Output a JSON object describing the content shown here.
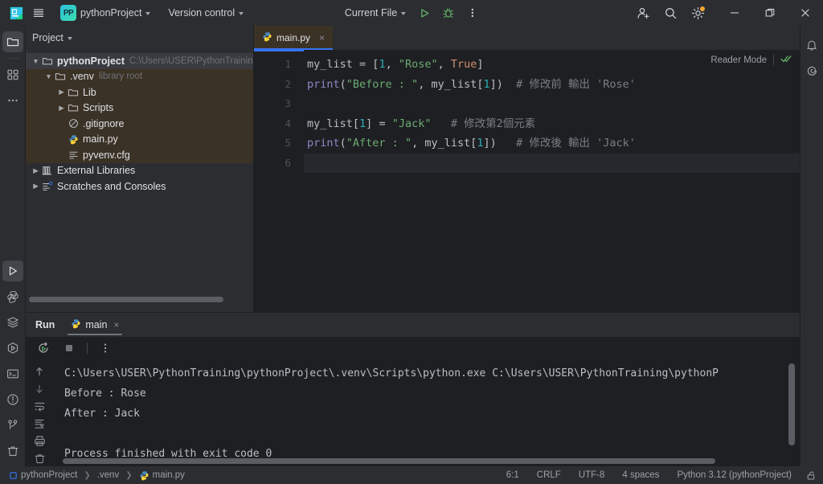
{
  "titlebar": {
    "app_icon": "pycharm-icon",
    "menu_icon": "hamburger-menu-icon",
    "project_badge": "PP",
    "project_name": "pythonProject",
    "version_control": "Version control",
    "run_config": "Current File",
    "run_icon": "run-icon",
    "debug_icon": "debug-icon",
    "more_icon": "more-vertical-icon",
    "account_icon": "add-account-icon",
    "search_icon": "search-icon",
    "settings_icon": "gear-icon",
    "minimize": "minimize-icon",
    "maximize": "maximize-icon",
    "close": "close-icon",
    "accent_blue": "#3574f0",
    "badge_orange": "#f0a732"
  },
  "left_rail": {
    "items": [
      {
        "name": "project-tool-window",
        "icon": "folder-icon",
        "active": true
      },
      {
        "name": "plugins-tool-window",
        "icon": "grid-icon",
        "active": false
      },
      {
        "name": "more-tool-windows",
        "icon": "ellipsis-icon",
        "active": false
      }
    ],
    "bottom_items": [
      {
        "name": "run-tool-window",
        "icon": "play-icon",
        "active": true
      },
      {
        "name": "python-console-tool-window",
        "icon": "python-icon",
        "active": false
      },
      {
        "name": "database-tool-window",
        "icon": "layers-icon",
        "active": false
      },
      {
        "name": "services-tool-window",
        "icon": "services-play-icon",
        "active": false
      },
      {
        "name": "terminal-tool-window",
        "icon": "terminal-icon",
        "active": false
      },
      {
        "name": "problems-tool-window",
        "icon": "warning-circle-icon",
        "active": false
      },
      {
        "name": "version-control-tool-window",
        "icon": "branch-icon",
        "active": false
      },
      {
        "name": "trash-tool-window",
        "icon": "trash-icon",
        "active": false
      }
    ]
  },
  "right_rail": {
    "items": [
      {
        "name": "notifications",
        "icon": "bell-icon"
      },
      {
        "name": "ai-assistant",
        "icon": "spiral-icon"
      }
    ]
  },
  "project_panel": {
    "header": "Project",
    "tree": [
      {
        "depth": 0,
        "arrow": "down",
        "icon": "folder-icon",
        "label": "pythonProject",
        "bold": true,
        "sub": "C:\\Users\\USER\\PythonTraining\\pythonP",
        "selected": true,
        "excluded": false
      },
      {
        "depth": 1,
        "arrow": "down",
        "icon": "folder-icon",
        "label": ".venv",
        "bold": false,
        "sub": "library root",
        "selected": false,
        "excluded": true
      },
      {
        "depth": 2,
        "arrow": "right",
        "icon": "folder-icon",
        "label": "Lib",
        "bold": false,
        "sub": "",
        "selected": false,
        "excluded": true
      },
      {
        "depth": 2,
        "arrow": "right",
        "icon": "folder-icon",
        "label": "Scripts",
        "bold": false,
        "sub": "",
        "selected": false,
        "excluded": true
      },
      {
        "depth": 2,
        "arrow": "none",
        "icon": "gitignore-icon",
        "label": ".gitignore",
        "bold": false,
        "sub": "",
        "selected": false,
        "excluded": true
      },
      {
        "depth": 2,
        "arrow": "none",
        "icon": "python-icon",
        "label": "main.py",
        "bold": false,
        "sub": "",
        "selected": false,
        "excluded": true
      },
      {
        "depth": 2,
        "arrow": "none",
        "icon": "config-icon",
        "label": "pyvenv.cfg",
        "bold": false,
        "sub": "",
        "selected": false,
        "excluded": true
      },
      {
        "depth": 0,
        "arrow": "right",
        "icon": "library-icon",
        "label": "External Libraries",
        "bold": false,
        "sub": "",
        "selected": false,
        "excluded": false
      },
      {
        "depth": 0,
        "arrow": "right",
        "icon": "scratches-icon",
        "label": "Scratches and Consoles",
        "bold": false,
        "sub": "",
        "selected": false,
        "excluded": false
      }
    ]
  },
  "editor": {
    "tab": {
      "label": "main.py",
      "icon": "python-icon",
      "close": "×"
    },
    "reader_mode": {
      "label": "Reader Mode",
      "check_icon": "double-check-icon",
      "check_color": "#5fad65"
    },
    "line_numbers": [
      "1",
      "2",
      "3",
      "4",
      "5",
      "6"
    ],
    "lines": [
      [
        {
          "t": "my_list ",
          "c": "tok-var"
        },
        {
          "t": "= ",
          "c": "tok-punct"
        },
        {
          "t": "[",
          "c": "tok-punct"
        },
        {
          "t": "1",
          "c": "tok-num"
        },
        {
          "t": ", ",
          "c": "tok-punct"
        },
        {
          "t": "\"Rose\"",
          "c": "tok-str"
        },
        {
          "t": ", ",
          "c": "tok-punct"
        },
        {
          "t": "True",
          "c": "tok-kw"
        },
        {
          "t": "]",
          "c": "tok-punct"
        }
      ],
      [
        {
          "t": "print",
          "c": "tok-fn"
        },
        {
          "t": "(",
          "c": "tok-punct"
        },
        {
          "t": "\"Before : \"",
          "c": "tok-str"
        },
        {
          "t": ", my_list[",
          "c": "tok-punct"
        },
        {
          "t": "1",
          "c": "tok-num"
        },
        {
          "t": "])",
          "c": "tok-punct"
        },
        {
          "t": "  # 修改前 輸出 'Rose'",
          "c": "tok-com"
        }
      ],
      [],
      [
        {
          "t": "my_list[",
          "c": "tok-var"
        },
        {
          "t": "1",
          "c": "tok-num"
        },
        {
          "t": "] ",
          "c": "tok-punct"
        },
        {
          "t": "= ",
          "c": "tok-punct"
        },
        {
          "t": "\"Jack\"",
          "c": "tok-str"
        },
        {
          "t": "   # 修改第2個元素",
          "c": "tok-com"
        }
      ],
      [
        {
          "t": "print",
          "c": "tok-fn"
        },
        {
          "t": "(",
          "c": "tok-punct"
        },
        {
          "t": "\"After : \"",
          "c": "tok-str"
        },
        {
          "t": ", my_list[",
          "c": "tok-punct"
        },
        {
          "t": "1",
          "c": "tok-num"
        },
        {
          "t": "])",
          "c": "tok-punct"
        },
        {
          "t": "   # 修改後 輸出 'Jack'",
          "c": "tok-com"
        }
      ],
      []
    ]
  },
  "run_panel": {
    "title": "Run",
    "tab": {
      "label": "main",
      "icon": "python-icon",
      "close": "×"
    },
    "toolbar": [
      {
        "name": "rerun-button",
        "icon": "rerun-icon"
      },
      {
        "name": "stop-button",
        "icon": "stop-icon"
      },
      {
        "name": "more-options-button",
        "icon": "more-vertical-icon"
      }
    ],
    "side_toolbar": [
      {
        "name": "scroll-up-button",
        "icon": "arrow-up-icon"
      },
      {
        "name": "scroll-down-button",
        "icon": "arrow-down-icon"
      },
      {
        "name": "soft-wrap-button",
        "icon": "wrap-icon"
      },
      {
        "name": "scroll-to-end-button",
        "icon": "scroll-end-icon"
      },
      {
        "name": "print-button",
        "icon": "print-icon"
      },
      {
        "name": "clear-all-button",
        "icon": "trash-icon"
      }
    ],
    "console_lines": [
      "C:\\Users\\USER\\PythonTraining\\pythonProject\\.venv\\Scripts\\python.exe C:\\Users\\USER\\PythonTraining\\pythonP",
      "Before : Rose",
      "After : Jack",
      "",
      "Process finished with exit code 0"
    ]
  },
  "statusbar": {
    "crumbs": [
      {
        "label": "pythonProject",
        "icon": "module-icon"
      },
      {
        "label": ".venv",
        "icon": ""
      },
      {
        "label": "main.py",
        "icon": "python-icon"
      }
    ],
    "caret_position": "6:1",
    "line_separator": "CRLF",
    "encoding": "UTF-8",
    "indent": "4 spaces",
    "interpreter": "Python 3.12 (pythonProject)",
    "lock_icon": "unlock-icon"
  }
}
